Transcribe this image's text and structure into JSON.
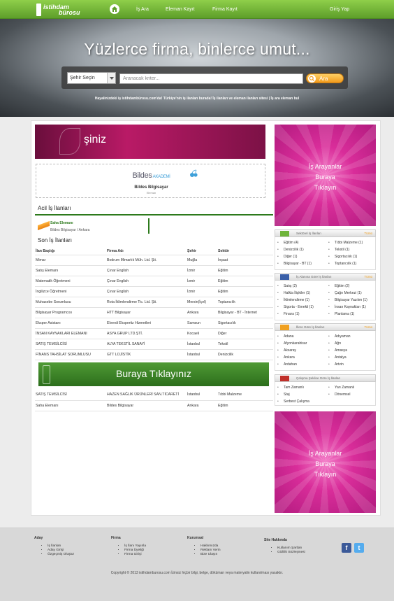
{
  "brand": {
    "logo_line1": "istihdam",
    "logo_line2": "bürosu"
  },
  "nav": {
    "items": [
      "İş Ara",
      "Eleman Kayıt",
      "Firma Kayıt"
    ],
    "login": "Giriş Yap"
  },
  "hero": {
    "slogan": "Yüzlerce firma, binlerce umut...",
    "city_select": "Şehir Seçin",
    "keyword_placeholder": "Aranacak kriter...",
    "search_button": "Ara",
    "subtitle": "Hayalinizdeki iş istihdambürosu.com'da! Türkiye'nin iş ilanları burada! İş ilanları ve eleman ilanları sitesi | İş ara eleman bul"
  },
  "banner_top": {
    "text": "şiniz"
  },
  "sponsor": {
    "logo_part1": "Bildes",
    "logo_part2": "AKADEMİ",
    "company": "Bildes Bilgisayar",
    "role": "Eleman"
  },
  "urgent": {
    "title": "Acil İş İlanları",
    "job_title": "Saha Elemanı",
    "job_detail": "Bildes Bilgisayar / Ankara"
  },
  "latest": {
    "title": "Son İş İlanları",
    "headers": [
      "İlan Başlığı",
      "Firma Adı",
      "Şehir",
      "Sektör"
    ],
    "rows": [
      [
        "Mimar",
        "Bodrum Mimarlık Müh. Ltd. Şti.",
        "Muğla",
        "İnşaat"
      ],
      [
        "Satış Elemanı",
        "Çınar English",
        "İzmir",
        "Eğitim"
      ],
      [
        "Matematik Öğretmeni",
        "Çınar English",
        "İzmir",
        "Eğitim"
      ],
      [
        "İngilizce Öğretmeni",
        "Çınar English",
        "İzmir",
        "Eğitim"
      ],
      [
        "Muhasebe Sorumlusu",
        "Rota İklimlendirme Tic. Ltd. Şti.",
        "Mersin(İçel)",
        "Toptancılık"
      ],
      [
        "Bilgisayar Programcısı",
        "HTT Bilgisayar",
        "Ankara",
        "Bilgisayar - BT - İnternet"
      ],
      [
        "Eksper Asistanı",
        "Elverdi Ekspertiz Hizmetleri",
        "Samsun",
        "Sigortacılık"
      ],
      [
        "İNSAN KAYNAKLARI ELEMANI",
        "ASYA GRUP LTD.ŞTİ.",
        "Kocaeli",
        "Diğer"
      ],
      [
        "SATIŞ TEMSİLCİSİ",
        "ALYA TEKSTİL SANAYİ",
        "İstanbul",
        "Tekstil"
      ],
      [
        "FİNANS TAHSİLAT SORUMLUSU",
        "GTT LOJİSTİK",
        "İstanbul",
        "Denizcilik"
      ]
    ],
    "rows_after": [
      [
        "SATIŞ TEMSİLCİSİ",
        "HAZEN SAĞLIK ÜRÜNLERİ SAN.TİCARETİ",
        "İstanbul",
        "Tıbbi Malzeme"
      ],
      [
        "Saha Elemanı",
        "Bildes Bilgisayar",
        "Ankara",
        "Eğitim"
      ]
    ]
  },
  "banner_mid": {
    "text": "Buraya Tıklayınız"
  },
  "ad": {
    "line1": "İş Arayanlar",
    "line2": "Buraya",
    "line3": "Tıklayın"
  },
  "panels": {
    "sectors": {
      "title": "Sektörel İş İlanları",
      "all": "Tümü",
      "left": [
        "Eğitim (4)",
        "Denizcilik (1)",
        "Diğer (1)",
        "Bilgisayar - BT (1)"
      ],
      "right": [
        "Tıbbi Malzeme (1)",
        "Tekstil (1)",
        "Sigortacılık (1)",
        "Toptancılık (1)"
      ]
    },
    "fields": {
      "title": "İş Alanına Göre İş İlanları",
      "all": "Tümü",
      "left": [
        "Satış (2)",
        "Halkla İlişkiler (1)",
        "İklimlendirme (1)",
        "Sigorta - Emekli (1)",
        "Finans (1)"
      ],
      "right": [
        "Eğitim (2)",
        "Çağrı Merkezi (1)",
        "Bilgisayar Yazılım (1)",
        "İnsan Kaynakları (1)",
        "Planlama (1)"
      ]
    },
    "cities": {
      "title": "İllere Göre İş İlanları",
      "all": "Tümü",
      "left": [
        "Adana",
        "Afyonkarahisar",
        "Aksaray",
        "Ankara",
        "Ardahan"
      ],
      "right": [
        "Adıyaman",
        "Ağrı",
        "Amasya",
        "Antalya",
        "Artvin"
      ]
    },
    "worktype": {
      "title": "Çalışma Şekline Göre İş İlanları",
      "left": [
        "Tam Zamanlı",
        "Staj",
        "Serbest Çalışma"
      ],
      "right": [
        "Yarı Zamanlı",
        "Dönemsel"
      ]
    }
  },
  "footer": {
    "cols": [
      {
        "title": "Aday",
        "items": [
          "İş İlanları",
          "Aday Girişi",
          "Özgeçmiş Oluştur"
        ]
      },
      {
        "title": "Firma",
        "items": [
          "İş İlanı Yayınla",
          "Firma Üyeliği",
          "Firma Girişi"
        ]
      },
      {
        "title": "Kurumsal",
        "items": [
          "Hakkımızda",
          "Reklam Verin",
          "Bize Ulaşın"
        ]
      },
      {
        "title": "Site Hakkında",
        "items": [
          "Kullanım Şartları",
          "Gizlilik Sözleşmesi"
        ]
      }
    ],
    "social": [
      "f",
      "t"
    ],
    "copyright": "Copyright © 2013 istihdamburosu.com İzinsiz hiçbir bilgi, belge, döküman veya materyalin kullanılması yasaktır."
  },
  "colors": {
    "brand_green": "#5d9e2a",
    "accent_orange": "#f39b1c",
    "ad_pink": "#d92d9a"
  }
}
